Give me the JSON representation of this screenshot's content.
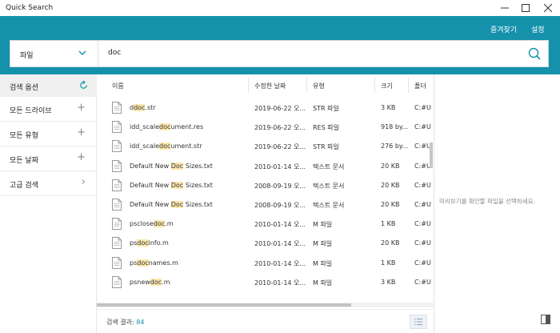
{
  "window": {
    "title": "Quick Search"
  },
  "header": {
    "favorites_label": "즐겨찾기",
    "settings_label": "설정"
  },
  "search": {
    "type_value": "파일",
    "query": "doc"
  },
  "left_panel": {
    "title": "검색 옵션",
    "items": [
      {
        "label": "모든 드라이브",
        "symbol": "+"
      },
      {
        "label": "모든 유형",
        "symbol": "+"
      },
      {
        "label": "모든 날짜",
        "symbol": "+"
      },
      {
        "label": "고급 검색",
        "symbol": "›"
      }
    ]
  },
  "columns": [
    "이름",
    "수정한 날짜",
    "유형",
    "크기",
    "폴더"
  ],
  "rows": [
    {
      "name": [
        "d",
        "doc",
        ".str"
      ],
      "date": "2019-06-22 오...",
      "type": "STR 파일",
      "size": "3 KB",
      "folder": "C:#U"
    },
    {
      "name": [
        "idd_scale",
        "doc",
        "ument.res"
      ],
      "date": "2019-06-22 오...",
      "type": "RES 파일",
      "size": "918 by...",
      "folder": "C:#U"
    },
    {
      "name": [
        "idd_scale",
        "doc",
        "ument.str"
      ],
      "date": "2019-06-22 오...",
      "type": "STR 파일",
      "size": "276 by...",
      "folder": "C:#U"
    },
    {
      "name": [
        "Default New ",
        "Doc",
        " Sizes.txt"
      ],
      "date": "2010-01-14 오...",
      "type": "텍스트 문서",
      "size": "20 KB",
      "folder": "C:#U"
    },
    {
      "name": [
        "Default New ",
        "Doc",
        " Sizes.txt"
      ],
      "date": "2008-09-19 오...",
      "type": "텍스트 문서",
      "size": "20 KB",
      "folder": "C:#U"
    },
    {
      "name": [
        "Default New ",
        "Doc",
        " Sizes.txt"
      ],
      "date": "2008-09-19 오...",
      "type": "텍스트 문서",
      "size": "20 KB",
      "folder": "C:#U"
    },
    {
      "name": [
        "psclose",
        "doc",
        ".m"
      ],
      "date": "2010-01-14 오...",
      "type": "M 파일",
      "size": "1 KB",
      "folder": "C:#U"
    },
    {
      "name": [
        "ps",
        "doc",
        "info.m"
      ],
      "date": "2010-01-14 오...",
      "type": "M 파일",
      "size": "20 KB",
      "folder": "C:#U"
    },
    {
      "name": [
        "ps",
        "doc",
        "names.m"
      ],
      "date": "2010-01-14 오...",
      "type": "M 파일",
      "size": "1 KB",
      "folder": "C:#U"
    },
    {
      "name": [
        "psnew",
        "doc",
        ".m"
      ],
      "date": "2010-01-14 오...",
      "type": "M 파일",
      "size": "3 KB",
      "folder": "C:#U"
    }
  ],
  "footer": {
    "status_label": "검색 결과: ",
    "count": "84"
  },
  "preview": {
    "message": "미리보기를 확인할 파일을 선택하세요."
  },
  "colors": {
    "accent": "#1591ac",
    "highlight": "#fbe7ad"
  },
  "icons": {
    "minimize": "minimize-icon",
    "maximize": "maximize-icon",
    "close": "close-icon",
    "search": "search-icon",
    "dropdown": "chevron-down-icon",
    "refresh": "refresh-icon",
    "file": "file-icon",
    "list_view": "list-view-icon",
    "preview_toggle": "panel-toggle-icon"
  }
}
